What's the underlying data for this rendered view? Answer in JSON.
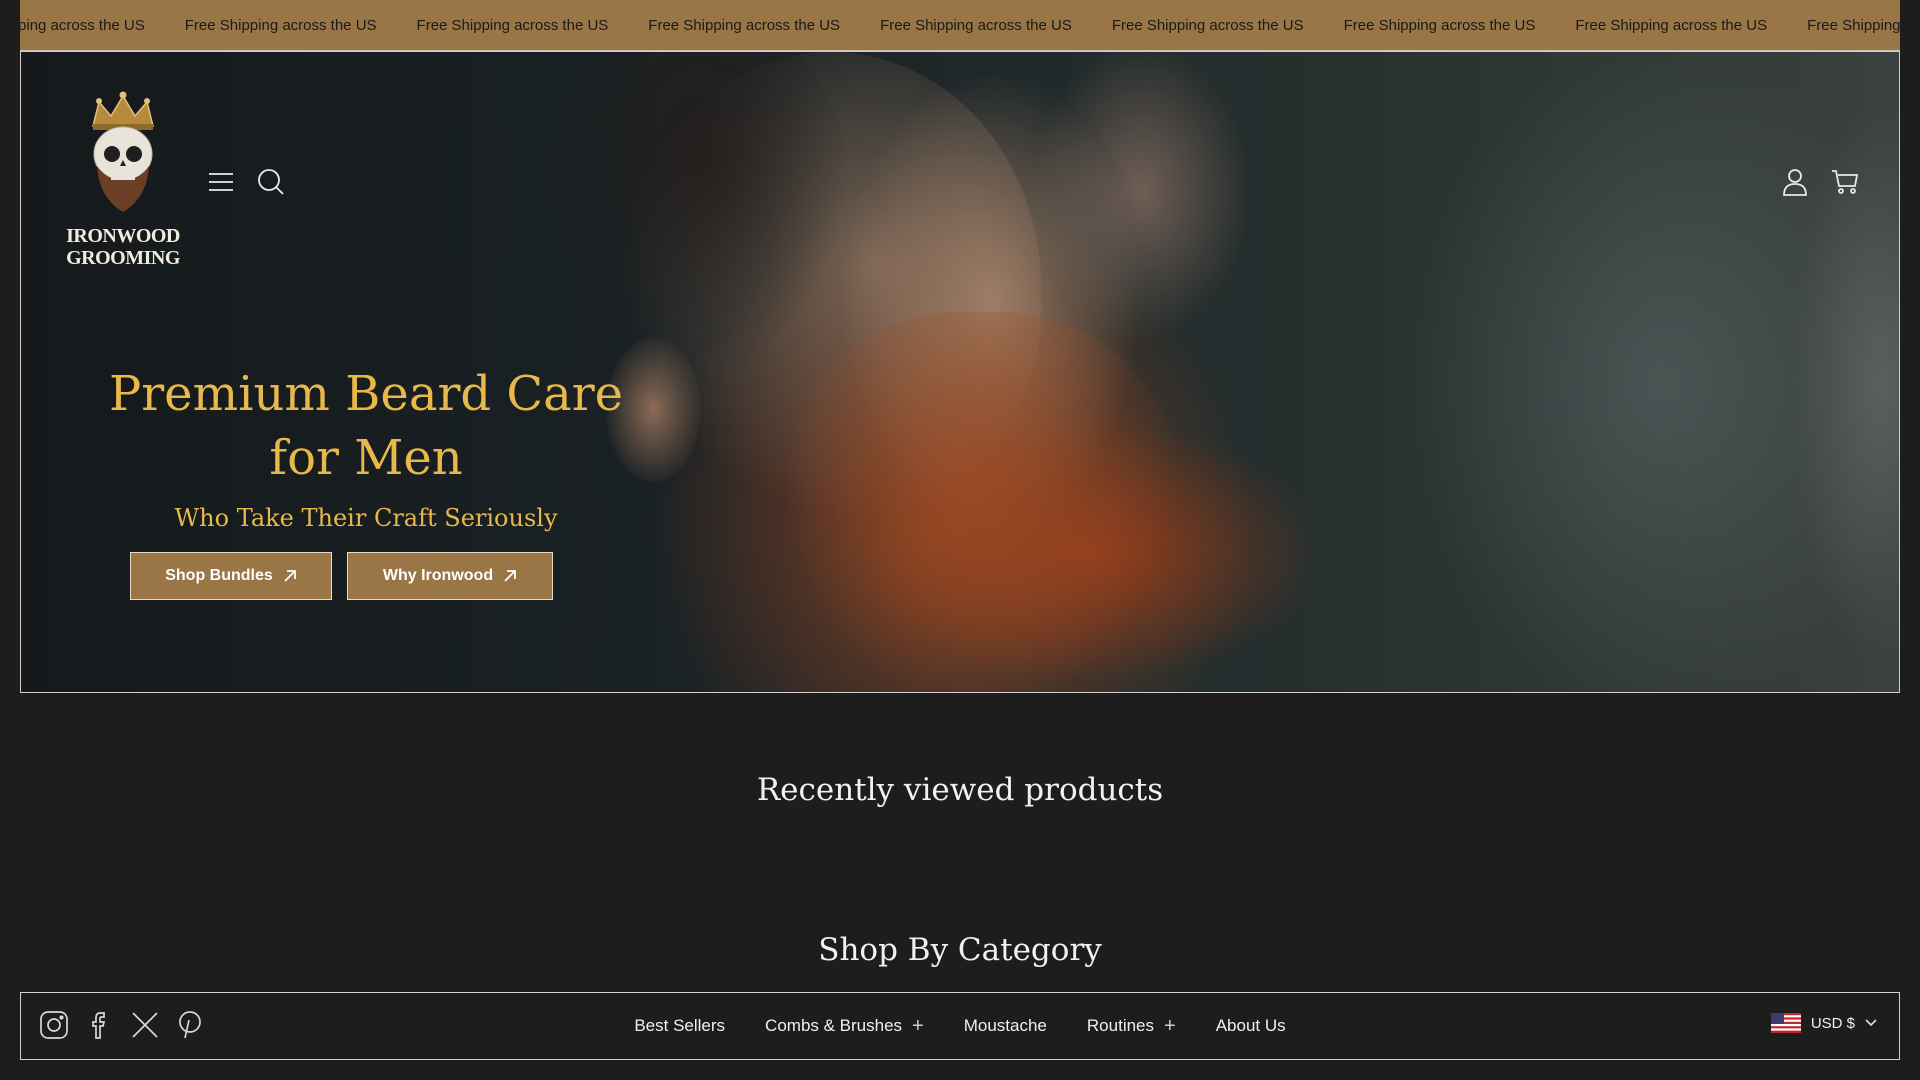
{
  "announcement": {
    "text": "Free Shipping across the US",
    "repeat": [
      "Shipping across the US",
      "Free Shipping across the US",
      "Free Shipping across the US",
      "Free Shipping across the US",
      "Free Shipping across the US",
      "Free Shipping across the US",
      "Free Shipping across the US",
      "Free Shipping across the US",
      "Free Shipping"
    ],
    "bar_color": "#9a7647"
  },
  "header": {
    "logo_text_line1": "IRONWOOD",
    "logo_text_line2": "GROOMING",
    "icons": [
      "hamburger-menu-icon",
      "search-icon",
      "account-icon",
      "cart-icon"
    ]
  },
  "hero": {
    "title": "Premium Beard Care for Men",
    "subtitle": "Who Take Their Craft Seriously",
    "buttons": [
      {
        "label": "Shop Bundles",
        "icon": "arrow-up-right-icon"
      },
      {
        "label": "Why Ironwood",
        "icon": "arrow-up-right-icon"
      }
    ],
    "accent_color": "#e8b84a"
  },
  "sections": {
    "recently_viewed": "Recently viewed products",
    "shop_by_category": "Shop By Category"
  },
  "bottom_nav": {
    "social": [
      "instagram-icon",
      "facebook-icon",
      "x-icon",
      "pinterest-icon"
    ],
    "links": [
      {
        "label": "Best Sellers",
        "expandable": false
      },
      {
        "label": "Combs & Brushes",
        "expandable": true
      },
      {
        "label": "Moustache",
        "expandable": false
      },
      {
        "label": "Routines",
        "expandable": true
      },
      {
        "label": "About Us",
        "expandable": false
      }
    ],
    "currency": "USD $",
    "flag": "us-flag-icon"
  }
}
